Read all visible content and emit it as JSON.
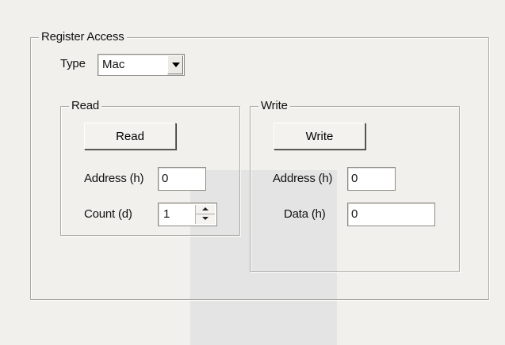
{
  "register_access": {
    "title": "Register Access",
    "type_label": "Type",
    "type_value": "Mac"
  },
  "read": {
    "group_title": "Read",
    "button_label": "Read",
    "address_label": "Address (h)",
    "address_value": "0",
    "count_label": "Count (d)",
    "count_value": "1"
  },
  "write": {
    "group_title": "Write",
    "button_label": "Write",
    "address_label": "Address (h)",
    "address_value": "0",
    "data_label": "Data (h)",
    "data_value": "0"
  },
  "icons": {
    "type_dropdown": "chevron-down-icon",
    "count_spinner_up": "spin-up-icon",
    "count_spinner_down": "spin-down-icon"
  }
}
